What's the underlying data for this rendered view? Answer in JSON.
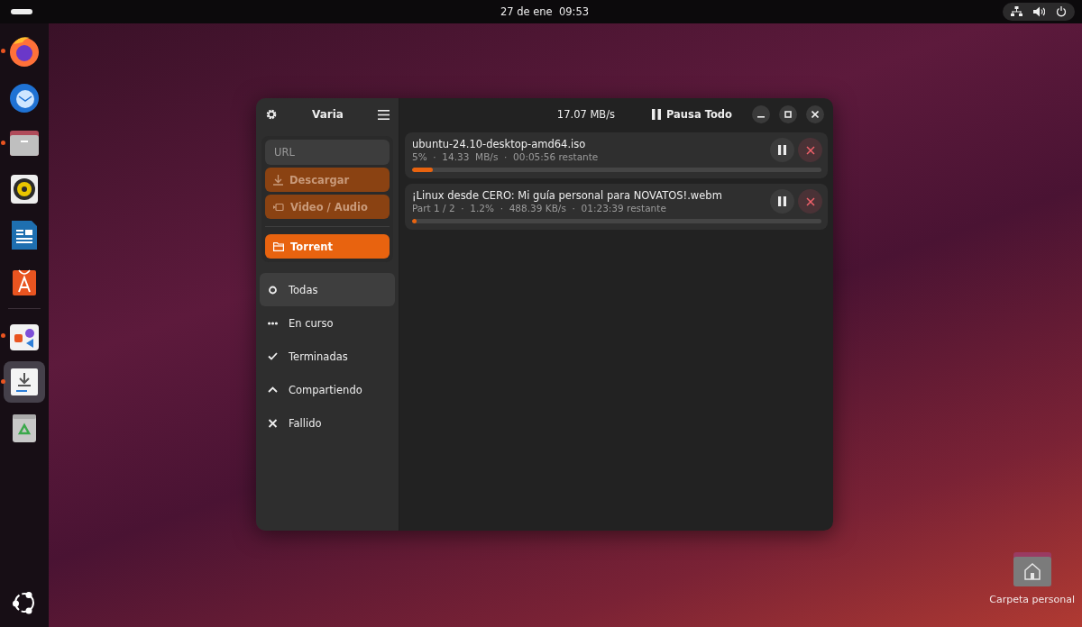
{
  "top_bar": {
    "clock": "27 de ene  09:53"
  },
  "dock": [
    {
      "kind": "firefox",
      "running": true,
      "focused": false
    },
    {
      "kind": "mail",
      "running": false,
      "focused": false
    },
    {
      "kind": "files",
      "running": true,
      "focused": false
    },
    {
      "kind": "speaker",
      "running": false,
      "focused": false
    },
    {
      "kind": "writer",
      "running": false,
      "focused": false
    },
    {
      "kind": "appcenter",
      "running": false,
      "focused": false
    },
    {
      "kind": "separator"
    },
    {
      "kind": "shapes",
      "running": true,
      "focused": false
    },
    {
      "kind": "downloader",
      "running": true,
      "focused": true
    },
    {
      "kind": "trash",
      "running": false,
      "focused": false
    }
  ],
  "window": {
    "sidebar": {
      "title": "Varia",
      "url_field": {
        "placeholder": "URL"
      },
      "actions": [
        {
          "kind": "download",
          "label": "Descargar",
          "disabled": true
        },
        {
          "kind": "video",
          "label": "Video / Audio",
          "disabled": true
        },
        {
          "kind": "folder",
          "label": "Torrent",
          "disabled": false
        }
      ],
      "filters": [
        {
          "kind": "circle",
          "label": "Todas",
          "selected": true
        },
        {
          "kind": "dots",
          "label": "En curso",
          "selected": false
        },
        {
          "kind": "check",
          "label": "Terminadas",
          "selected": false
        },
        {
          "kind": "up",
          "label": "Compartiendo",
          "selected": false
        },
        {
          "kind": "cross",
          "label": "Fallido",
          "selected": false
        }
      ]
    },
    "header": {
      "speed": "17.07 MB/s",
      "pause_all": "Pausa Todo"
    },
    "downloads": [
      {
        "name": "ubuntu-24.10-desktop-amd64.iso",
        "details": "5%  ·  14.33  MB/s  ·  00:05:56 restante",
        "level": 0.05
      },
      {
        "name": "¡Linux desde CERO: Mi guía personal para NOVATOS!.webm",
        "details": "Part 1 / 2  ·  1.2%  ·  488.39 KB/s  ·  01:23:39 restante",
        "level": 0.012
      }
    ]
  },
  "desktop_icons": [
    {
      "label": "Carpeta personal"
    }
  ]
}
